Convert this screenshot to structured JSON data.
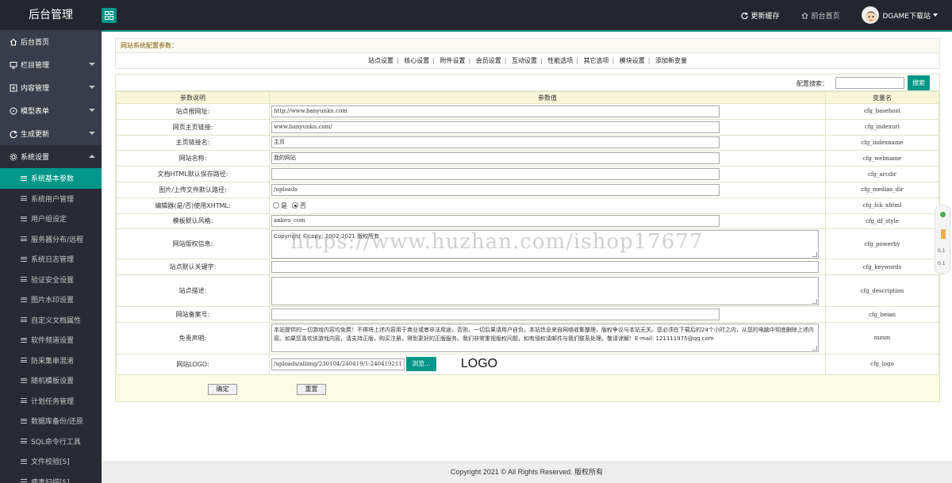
{
  "header": {
    "brand": "后台管理",
    "refresh_cache": "更新缓存",
    "front_home": "前台首页",
    "user_name": "DGAME下载站"
  },
  "sidebar": {
    "items": [
      {
        "label": "后台首页"
      },
      {
        "label": "栏目管理"
      },
      {
        "label": "内容管理"
      },
      {
        "label": "模型表单"
      },
      {
        "label": "生成更新"
      },
      {
        "label": "系统设置"
      }
    ],
    "sub_items": [
      "系统基本参数",
      "系统用户管理",
      "用户组设定",
      "服务器分布/远程",
      "系统日志管理",
      "验证安全设置",
      "图片水印设置",
      "自定义文档属性",
      "软件频道设置",
      "防采集串混淆",
      "随机模板设置",
      "计划任务管理",
      "数据库备份/还原",
      "SQL命令行工具",
      "文件校验[S]",
      "病毒扫描[S]"
    ]
  },
  "main": {
    "panel_title": "网站系统配置参数：",
    "tabs": [
      "站点设置",
      "核心设置",
      "附件设置",
      "会员设置",
      "互动设置",
      "性能选项",
      "其它选项",
      "模块设置",
      "添加新变量"
    ],
    "search_label": "配置搜索：",
    "search_button": "搜索",
    "columns": [
      "参数说明",
      "参数值",
      "变量名"
    ],
    "rows": [
      {
        "label": "站点根网址:",
        "value": "http://www.banyunku.com",
        "var": "cfg_basehost"
      },
      {
        "label": "网页主页链接:",
        "value": "www.banyunku.com/",
        "var": "cfg_indexurl"
      },
      {
        "label": "主页链接名:",
        "value": "主页",
        "var": "cfg_indexname"
      },
      {
        "label": "网站名称:",
        "value": "我的网站",
        "var": "cfg_webname"
      },
      {
        "label": "文档HTML默认保存路径:",
        "value": "",
        "var": "cfg_arcdir"
      },
      {
        "label": "图片/上传文件默认路径:",
        "value": "/uploads",
        "var": "cfg_medias_dir"
      },
      {
        "label": "编辑器(是/否)使用XHTML:",
        "value": "",
        "var": "cfg_fck_xhtml"
      },
      {
        "label": "模板默认风格:",
        "value": "ankeu_com",
        "var": "cfg_df_style"
      },
      {
        "label": "网站版权信息:",
        "value": "Copyright ©copy; 2002-2021 版权所有",
        "var": "cfg_powerby"
      },
      {
        "label": "站点默认关键字:",
        "value": "",
        "var": "cfg_keywords"
      },
      {
        "label": "站点描述:",
        "value": "",
        "var": "cfg_description"
      },
      {
        "label": "网站备案号:",
        "value": "",
        "var": "cfg_beian"
      },
      {
        "label": "免责声明:",
        "value": "本站提供的一切游戏内容均免费！不得将上述内容用于商业或者非法用途，否则，一切后果请用户自负。本站信息来自网络收集整理，版权争议与本站无关。您必须在下载后的24个小时之内，从您的电脑中彻底删除上述内容。如果您喜欢该游戏内容，请支持正版，购买注册，得到更好的正版服务。我们非常重视版权问题，如有侵权请邮件与我们联系处理。敬请谅解！E-mail: 121111975@qq.com",
        "var": "mzsm"
      },
      {
        "label": "网站LOGO:",
        "value": "/uploads/allimg/230104/240419/1-240419211",
        "var": "cfg_logo"
      }
    ],
    "radio_yes": "是",
    "radio_no": "否",
    "browse_label": "浏览...",
    "logo_text": "LOGO",
    "confirm_button": "确定",
    "reset_button": "重置"
  },
  "footer": {
    "copyright": "Copyright 2021 © All Rights Reserved. 版权所有"
  },
  "watermark": "https://www.huzhan.com/ishop17677",
  "side_widget": {
    "t1": "0.1",
    "t2": "0.1"
  },
  "colors": {
    "accent": "#009688",
    "sidebar": "#393d49",
    "topbar": "#23262e"
  }
}
